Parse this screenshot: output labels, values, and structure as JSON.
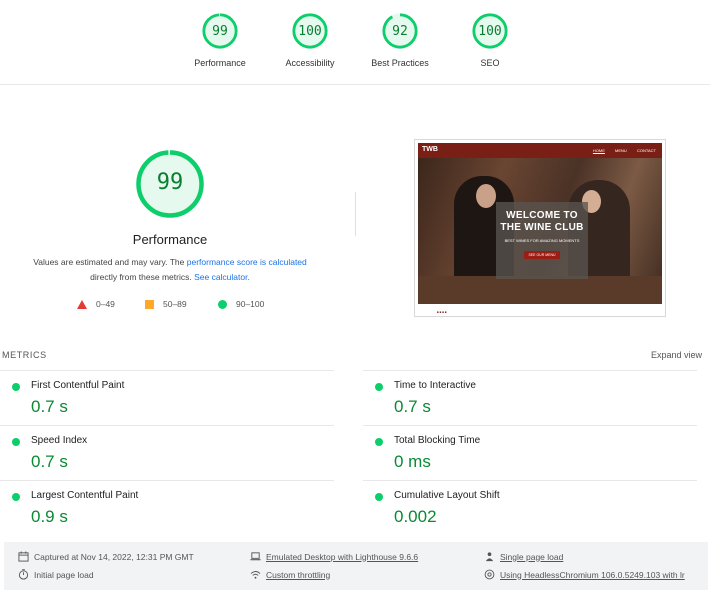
{
  "gauges": [
    {
      "label": "Performance",
      "score": "99",
      "fraction": 0.99,
      "name": "performance"
    },
    {
      "label": "Accessibility",
      "score": "100",
      "fraction": 1.0,
      "name": "accessibility"
    },
    {
      "label": "Best Practices",
      "score": "92",
      "fraction": 0.92,
      "name": "best-practices"
    },
    {
      "label": "SEO",
      "score": "100",
      "fraction": 1.0,
      "name": "seo"
    }
  ],
  "performance": {
    "score": "99",
    "score_fraction": 0.99,
    "title": "Performance",
    "desc_part1": "Values are estimated and may vary. The ",
    "desc_link1": "performance score is calculated",
    "desc_part2": " directly from these metrics. ",
    "desc_link2": "See calculator."
  },
  "legend": {
    "fail": "0–49",
    "average": "50–89",
    "pass": "90–100"
  },
  "thumbnail": {
    "brand": "TWB",
    "nav": [
      "HOME",
      "MENU",
      "CONTACT"
    ],
    "headline_line1": "WELCOME TO",
    "headline_line2": "THE WINE CLUB",
    "tagline": "BEST WINES FOR AMAZING MOMENTS",
    "cta": "SEE OUR MENU"
  },
  "metrics": {
    "title": "METRICS",
    "expand": "Expand view",
    "items": [
      {
        "label": "First Contentful Paint",
        "value": "0.7 s"
      },
      {
        "label": "Time to Interactive",
        "value": "0.7 s"
      },
      {
        "label": "Speed Index",
        "value": "0.7 s"
      },
      {
        "label": "Total Blocking Time",
        "value": "0 ms"
      },
      {
        "label": "Largest Contentful Paint",
        "value": "0.9 s"
      },
      {
        "label": "Cumulative Layout Shift",
        "value": "0.002"
      }
    ]
  },
  "footer": {
    "captured": "Captured at Nov 14, 2022, 12:31 PM GMT",
    "initial": "Initial page load",
    "emulated": "Emulated Desktop with Lighthouse 9.6.6",
    "throttling": "Custom throttling",
    "single": "Single page load",
    "using": "Using HeadlessChromium 106.0.5249.103 with lr"
  },
  "colors": {
    "pass": "#0cce6b",
    "pass_text": "#0a7e31",
    "pass_bg": "#e6f9ee",
    "average": "#ffa726",
    "fail": "#e53935",
    "link": "#1a73e8"
  }
}
